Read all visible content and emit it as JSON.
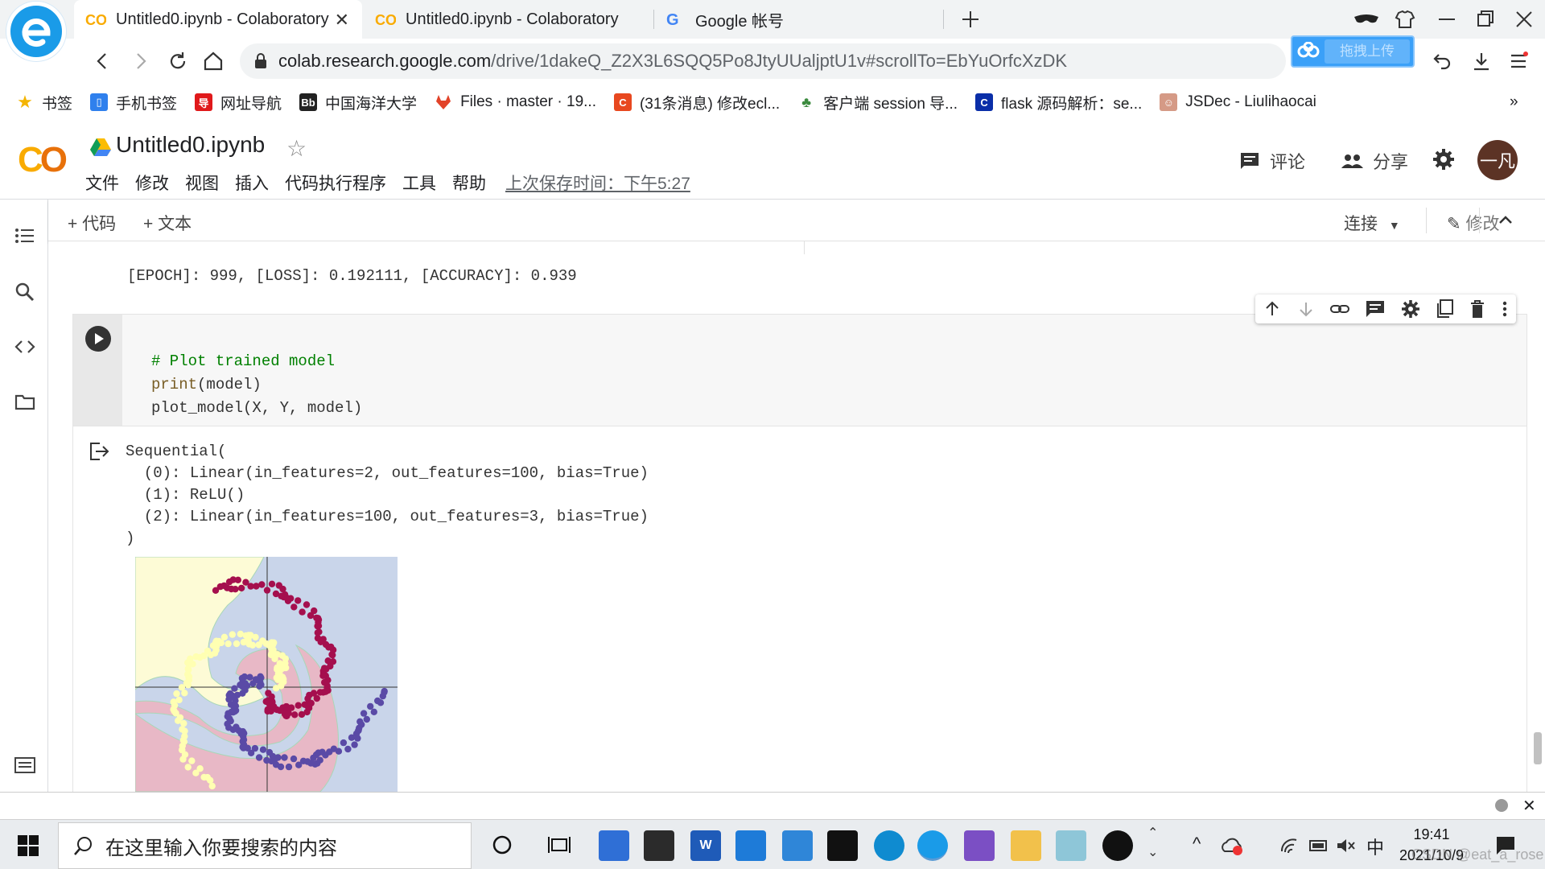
{
  "browser": {
    "tabs": [
      {
        "title": "Untitled0.ipynb - Colaboratory",
        "active": true
      },
      {
        "title": "Untitled0.ipynb - Colaboratory",
        "active": false
      },
      {
        "title": "Google 帐号",
        "active": false
      }
    ],
    "url_host": "colab.research.google.com",
    "url_path": "/drive/1dakeQ_Z2X3L6SQQ5Po8JtyUUaljptU1v#scrollTo=EbYuOrfcXzDK",
    "baidu_upload_label": "拖拽上传",
    "bookmarks": [
      {
        "label": "书签",
        "icon": "star-icon",
        "color": "#f4b400"
      },
      {
        "label": "手机书签",
        "icon": "phone-icon",
        "color": "#2f80ed"
      },
      {
        "label": "网址导航",
        "icon": "nav-site-icon",
        "color": "#e0191b"
      },
      {
        "label": "中国海洋大学",
        "icon": "bb-icon",
        "color": "#222222"
      },
      {
        "label": "Files · master · 19...",
        "icon": "gitlab-icon",
        "color": "#e24329"
      },
      {
        "label": "(31条消息) 修改ecl...",
        "icon": "csdn-icon",
        "color": "#e8481f"
      },
      {
        "label": "客户端 session 导...",
        "icon": "cactus-icon",
        "color": "#3b8a3e"
      },
      {
        "label": "flask 源码解析：se...",
        "icon": "c-logo-icon",
        "color": "#0a2ea8"
      },
      {
        "label": "JSDec - Liulihaocai",
        "icon": "avatar-girl-icon",
        "color": "#d59a86"
      }
    ]
  },
  "colab": {
    "notebook_title": "Untitled0.ipynb",
    "menus": [
      "文件",
      "修改",
      "视图",
      "插入",
      "代码执行程序",
      "工具",
      "帮助"
    ],
    "last_saved": "上次保存时间：下午5:27",
    "comment_label": "评论",
    "share_label": "分享",
    "avatar_text": "一凡",
    "add_code_label": "+ 代码",
    "add_text_label": "+ 文本",
    "connect_label": "连接",
    "edit_label": "修改"
  },
  "notebook": {
    "prev_output": "[EPOCH]: 999, [LOSS]: 0.192111, [ACCURACY]: 0.939",
    "code": {
      "comment": "#  Plot  trained  model",
      "line2_builtin": "print",
      "line2_rest": "(model)",
      "line3": "plot_model(X,  Y,  model)"
    },
    "output_text": "Sequential(\n  (0): Linear(in_features=2, out_features=100, bias=True)\n  (1): ReLU()\n  (2): Linear(in_features=100, out_features=3, bias=True)\n)",
    "plot": {
      "region_colors": {
        "yellow": "#fdfbd6",
        "blue": "#c9d5ea",
        "pink": "#e8b8c6"
      },
      "class_colors": [
        "#ffffb2",
        "#5a4aa6",
        "#a50f4e"
      ]
    }
  },
  "taskbar": {
    "search_placeholder": "在这里输入你要搜索的内容",
    "time": "19:41",
    "date": "2021/10/9",
    "ime": "中",
    "watermark": "CSDN @eat_a_rose"
  }
}
